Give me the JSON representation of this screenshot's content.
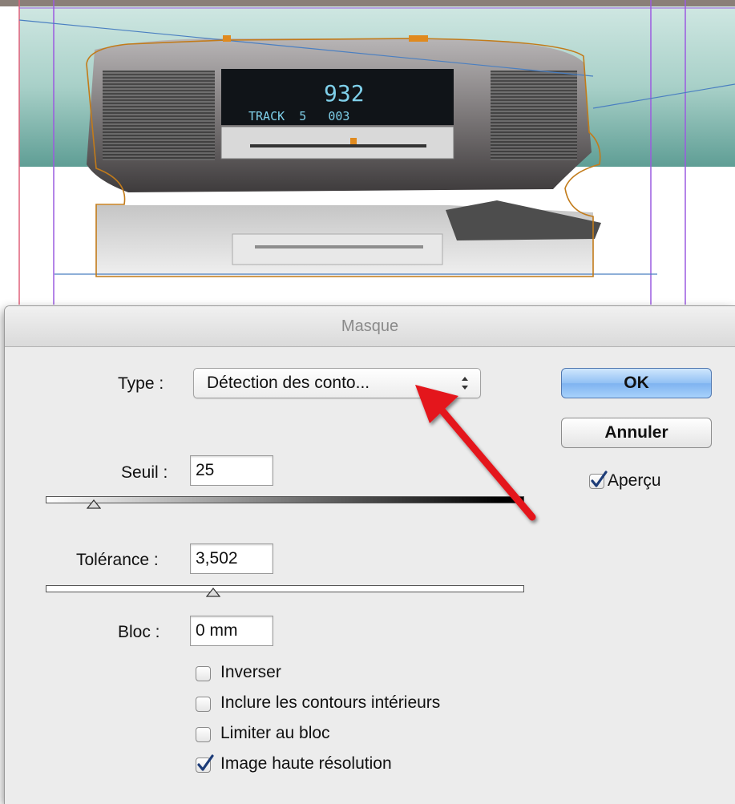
{
  "dialog": {
    "title": "Masque",
    "type_label": "Type :",
    "type_value": "Détection des conto...",
    "threshold_label": "Seuil :",
    "threshold_value": "25",
    "tolerance_label": "Tolérance :",
    "tolerance_value": "3,502",
    "inset_label": "Bloc :",
    "inset_value": "0 mm",
    "threshold_level": 0.1,
    "tolerance_level": 0.35,
    "ok_label": "OK",
    "cancel_label": "Annuler",
    "preview_label": "Aperçu",
    "preview_checked": true,
    "options": [
      {
        "label": "Inverser",
        "checked": false
      },
      {
        "label": "Inclure les contours intérieurs",
        "checked": false
      },
      {
        "label": "Limiter au bloc",
        "checked": false
      },
      {
        "label": "Image haute résolution",
        "checked": true
      }
    ]
  },
  "canvas": {
    "display_line1": "932",
    "display_line2": "TRACK  5   003"
  },
  "colors": {
    "accent": "#7fb3f0",
    "arrow": "#e4161e",
    "selection": "#c27b1a",
    "guide": "#9b5be0",
    "checkmark": "#1d3c78"
  },
  "icons": {
    "popup_arrows": "updown-chevron-icon",
    "checkmark": "checkmark-icon",
    "slider_thumb": "triangle-thumb-icon"
  }
}
